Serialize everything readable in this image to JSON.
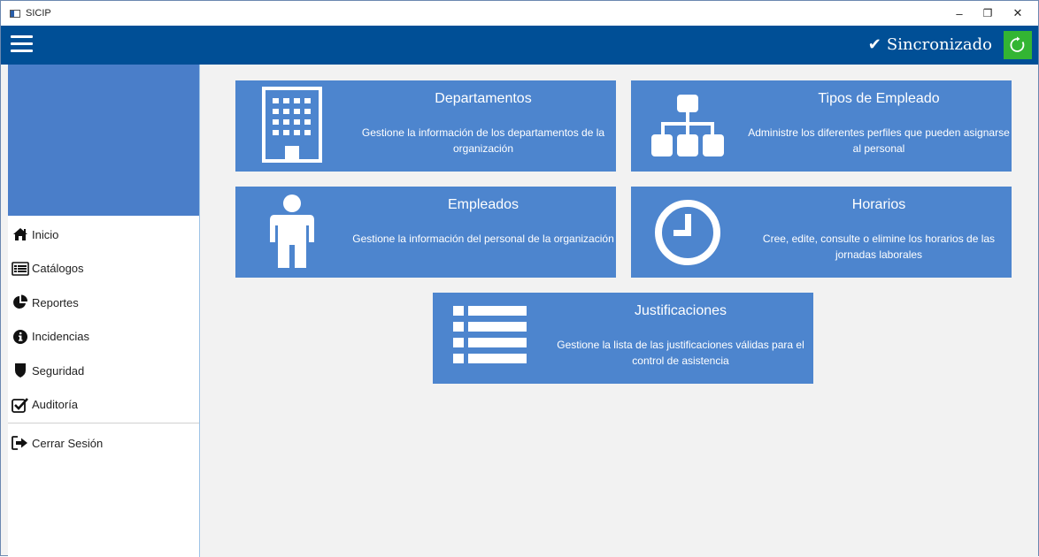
{
  "window": {
    "title": "SICIP",
    "minimize": "–",
    "maximize": "❐",
    "close": "✕"
  },
  "header": {
    "sync_check": "✔",
    "sync_label": "Sincronizado",
    "refresh_icon": "refresh-icon"
  },
  "sidebar": {
    "items": [
      {
        "label": "Inicio",
        "icon": "home-icon"
      },
      {
        "label": "Catálogos",
        "icon": "list-icon"
      },
      {
        "label": "Reportes",
        "icon": "pie-chart-icon"
      },
      {
        "label": "Incidencias",
        "icon": "info-icon"
      },
      {
        "label": "Seguridad",
        "icon": "shield-icon"
      },
      {
        "label": "Auditoría",
        "icon": "checkbox-icon"
      }
    ],
    "logout": {
      "label": "Cerrar Sesión",
      "icon": "sign-out-icon"
    }
  },
  "tiles": [
    {
      "title": "Departamentos",
      "description": "Gestione la información de los departamentos de la organización",
      "icon": "building-icon"
    },
    {
      "title": "Tipos de Empleado",
      "description": "Administre los diferentes perfiles que pueden asignarse al personal",
      "icon": "sitemap-icon"
    },
    {
      "title": "Empleados",
      "description": "Gestione la información del personal de la organización",
      "icon": "person-icon"
    },
    {
      "title": "Horarios",
      "description": "Cree, edite, consulte o elimine los horarios de las jornadas laborales",
      "icon": "clock-icon"
    },
    {
      "title": "Justificaciones",
      "description": "Gestione la lista de las justificaciones válidas para el control de asistencia",
      "icon": "list-icon"
    }
  ],
  "colors": {
    "header": "#004f96",
    "tile": "#4d85ce",
    "banner": "#4a7ec9",
    "sync_button": "#33b533"
  }
}
